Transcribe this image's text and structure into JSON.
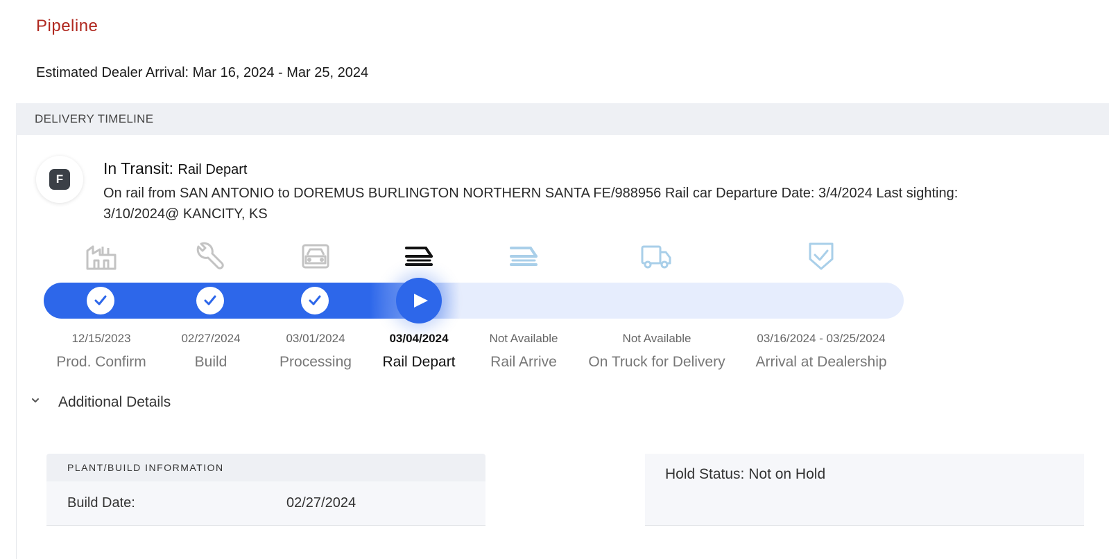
{
  "page": {
    "title": "Pipeline",
    "estimated_arrival": "Estimated Dealer Arrival: Mar 16, 2024 - Mar 25, 2024"
  },
  "timeline": {
    "header": "DELIVERY TIMELINE",
    "avatar_letter": "F",
    "status_label": "In Transit:",
    "status_value": "Rail Depart",
    "description": "On rail from SAN ANTONIO to DOREMUS BURLINGTON NORTHERN SANTA FE/988956 Rail car Departure Date: 3/4/2024 Last sighting: 3/10/2024@ KANCITY, KS",
    "progress_step": 4,
    "total_steps": 7,
    "steps": [
      {
        "date": "12/15/2023",
        "name": "Prod. Confirm",
        "icon": "factory-icon",
        "state": "complete"
      },
      {
        "date": "02/27/2024",
        "name": "Build",
        "icon": "wrench-icon",
        "state": "complete"
      },
      {
        "date": "03/01/2024",
        "name": "Processing",
        "icon": "car-front-icon",
        "state": "complete"
      },
      {
        "date": "03/04/2024",
        "name": "Rail Depart",
        "icon": "train-icon",
        "state": "current"
      },
      {
        "date": "Not Available",
        "name": "Rail Arrive",
        "icon": "train-arrive-icon",
        "state": "pending"
      },
      {
        "date": "Not Available",
        "name": "On Truck for Delivery",
        "icon": "truck-icon",
        "state": "pending"
      },
      {
        "date": "03/16/2024 - 03/25/2024",
        "name": "Arrival at Dealership",
        "icon": "shield-check-icon",
        "state": "pending"
      }
    ]
  },
  "details": {
    "toggle_label": "Additional Details",
    "plant_header": "PLANT/BUILD INFORMATION",
    "build_date_label": "Build Date:",
    "build_date_value": "02/27/2024",
    "hold_status": "Hold Status: Not on Hold"
  },
  "colors": {
    "brand_red": "#b0281f",
    "progress_blue": "#2d67ea",
    "track_pending": "#e6edfd",
    "icon_done": "#c3c3c3",
    "icon_pending": "#a9cfe9"
  }
}
